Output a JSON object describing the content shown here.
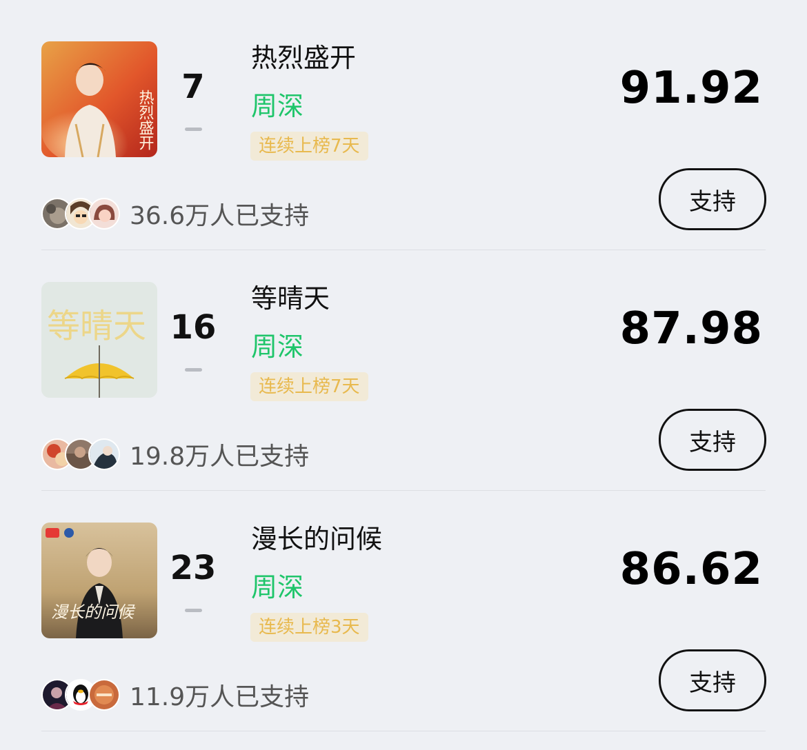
{
  "entries": [
    {
      "rank": "7",
      "rank_change": "—",
      "title": "热烈盛开",
      "artist": "周深",
      "streak": "连续上榜7天",
      "score": "91.92",
      "supporters": "36.6万人已支持",
      "support_label": "支持",
      "cover_text": "热烈盛开"
    },
    {
      "rank": "16",
      "rank_change": "—",
      "title": "等晴天",
      "artist": "周深",
      "streak": "连续上榜7天",
      "score": "87.98",
      "supporters": "19.8万人已支持",
      "support_label": "支持",
      "cover_text": "等晴天"
    },
    {
      "rank": "23",
      "rank_change": "—",
      "title": "漫长的问候",
      "artist": "周深",
      "streak": "连续上榜3天",
      "score": "86.62",
      "supporters": "11.9万人已支持",
      "support_label": "支持",
      "cover_text": "漫长的问候"
    }
  ],
  "colors": {
    "background": "#eef0f4",
    "artist": "#1fc56a",
    "streak_text": "#e8b94e",
    "streak_bg": "#f2ead7"
  }
}
